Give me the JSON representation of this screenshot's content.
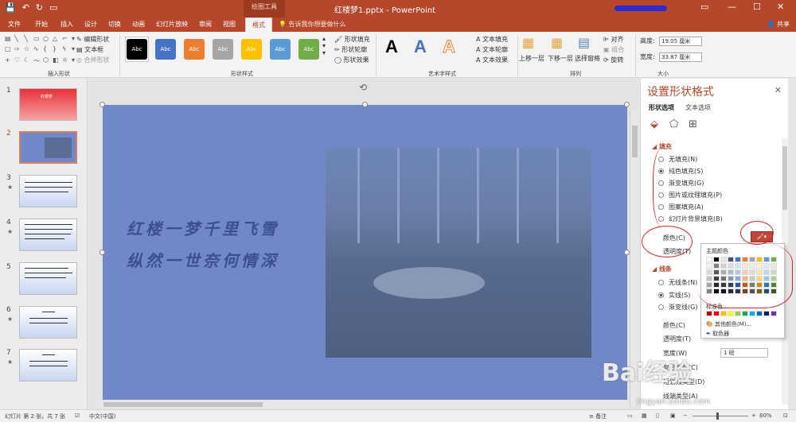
{
  "title_bar": {
    "context_tab": "绘图工具",
    "doc_title": "红楼梦1.pptx - PowerPoint",
    "quick_access": [
      "save-icon",
      "undo-icon",
      "redo-icon",
      "start-icon"
    ],
    "window_controls": [
      "—",
      "☐",
      "✕"
    ]
  },
  "tabs": [
    {
      "label": "文件"
    },
    {
      "label": "开始"
    },
    {
      "label": "插入"
    },
    {
      "label": "设计"
    },
    {
      "label": "切换"
    },
    {
      "label": "动画"
    },
    {
      "label": "幻灯片放映"
    },
    {
      "label": "审阅"
    },
    {
      "label": "视图"
    },
    {
      "label": "格式"
    }
  ],
  "tell_me": "告诉我你想要做什么",
  "share": "共享",
  "ribbon": {
    "insert_shapes": {
      "edit_shape": "编辑形状",
      "textbox": "文本框",
      "merge": "合并形状",
      "label": "插入形状"
    },
    "shape_styles": {
      "label": "形状样式",
      "fill": "形状填充",
      "outline": "形状轮廓",
      "effects": "形状效果",
      "sample": "Abc",
      "swatches": [
        "#000000",
        "#4472c4",
        "#ed7d31",
        "#a5a5a5",
        "#ffc000",
        "#5b9bd5",
        "#70ad47"
      ]
    },
    "wordart": {
      "label": "艺术字样式",
      "text_fill": "文本填充",
      "text_outline": "文本轮廓",
      "text_effects": "文本效果",
      "sample": "A"
    },
    "arrange": {
      "label": "排列",
      "bring_forward": "上移一层",
      "send_backward": "下移一层",
      "selection_pane": "选择窗格",
      "align": "对齐",
      "group": "组合",
      "rotate": "旋转"
    },
    "size": {
      "label": "大小",
      "height_label": "高度:",
      "height_value": "19.05 厘米",
      "width_label": "宽度:",
      "width_value": "33.87 厘米"
    }
  },
  "slides": [
    {
      "num": "1",
      "star": ""
    },
    {
      "num": "2",
      "star": ""
    },
    {
      "num": "3",
      "star": "★"
    },
    {
      "num": "4",
      "star": "★"
    },
    {
      "num": "5",
      "star": ""
    },
    {
      "num": "6",
      "star": "★"
    },
    {
      "num": "7",
      "star": "★"
    }
  ],
  "slide_text": {
    "title": "红楼梦",
    "line1": "红楼一梦千里飞雪",
    "line2": "纵然一世奈何情深"
  },
  "pane": {
    "title": "设置形状格式",
    "close": "✕",
    "tabs": [
      "形状选项",
      "文本选项"
    ],
    "fill": {
      "section": "填充",
      "options": [
        "无填充(N)",
        "纯色填充(S)",
        "渐变填充(G)",
        "图片或纹理填充(P)",
        "图案填充(A)",
        "幻灯片背景填充(B)"
      ],
      "selected_index": 1,
      "color_label": "颜色(C)",
      "transparency_label": "透明度(T)"
    },
    "line": {
      "section": "线条",
      "options": [
        "无线条(N)",
        "实线(S)",
        "渐变线(G)"
      ],
      "selected_index": 1,
      "color_label": "颜色(C)",
      "transparency_label": "透明度(T)",
      "width_label": "宽度(W)",
      "width_value": "1 磅",
      "compound_label": "复合类型(C)",
      "dash_label": "短划线类型(D)",
      "cap_label": "线端类型(A)"
    }
  },
  "color_popup": {
    "theme_header": "主题颜色",
    "standard_header": "标准色",
    "more_colors": "其他颜色(M)...",
    "eyedropper": "取色器",
    "theme_top": [
      "#ffffff",
      "#000000",
      "#e7e6e6",
      "#44546a",
      "#4472c4",
      "#ed7d31",
      "#a5a5a5",
      "#ffc000",
      "#5b9bd5",
      "#70ad47"
    ],
    "standard": [
      "#c00000",
      "#ff0000",
      "#ffc000",
      "#ffff00",
      "#92d050",
      "#00b050",
      "#00b0f0",
      "#0070c0",
      "#002060",
      "#7030a0"
    ]
  },
  "status": {
    "slide_info": "幻灯片 第 2 张，共 7 张",
    "language": "中文(中国)",
    "notes": "备注",
    "zoom": "80%"
  },
  "watermark": {
    "text": "Bai经验",
    "url": "jingyan.baidu.com"
  }
}
